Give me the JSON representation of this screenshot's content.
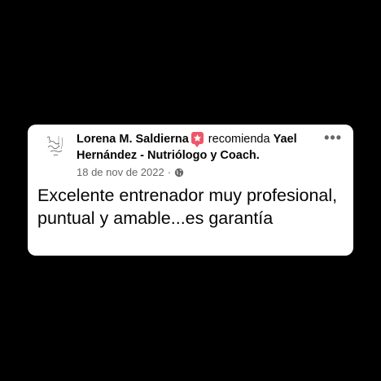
{
  "post": {
    "author": "Lorena M. Saldierna",
    "action": "recomienda",
    "page": "Yael Hernández - Nutriólogo y Coach.",
    "date": "18 de nov de 2022",
    "separator": "·",
    "body": "Excelente entrenador muy profesional, puntual y amable...es garantía",
    "icons": {
      "avatar": "handwritten-logo-avatar",
      "badge": "recommend-star-badge-icon",
      "privacy": "globe-icon",
      "menu": "more-options-icon"
    },
    "colors": {
      "badge": "#f0556a",
      "meta": "#65676b",
      "text": "#050505"
    }
  }
}
